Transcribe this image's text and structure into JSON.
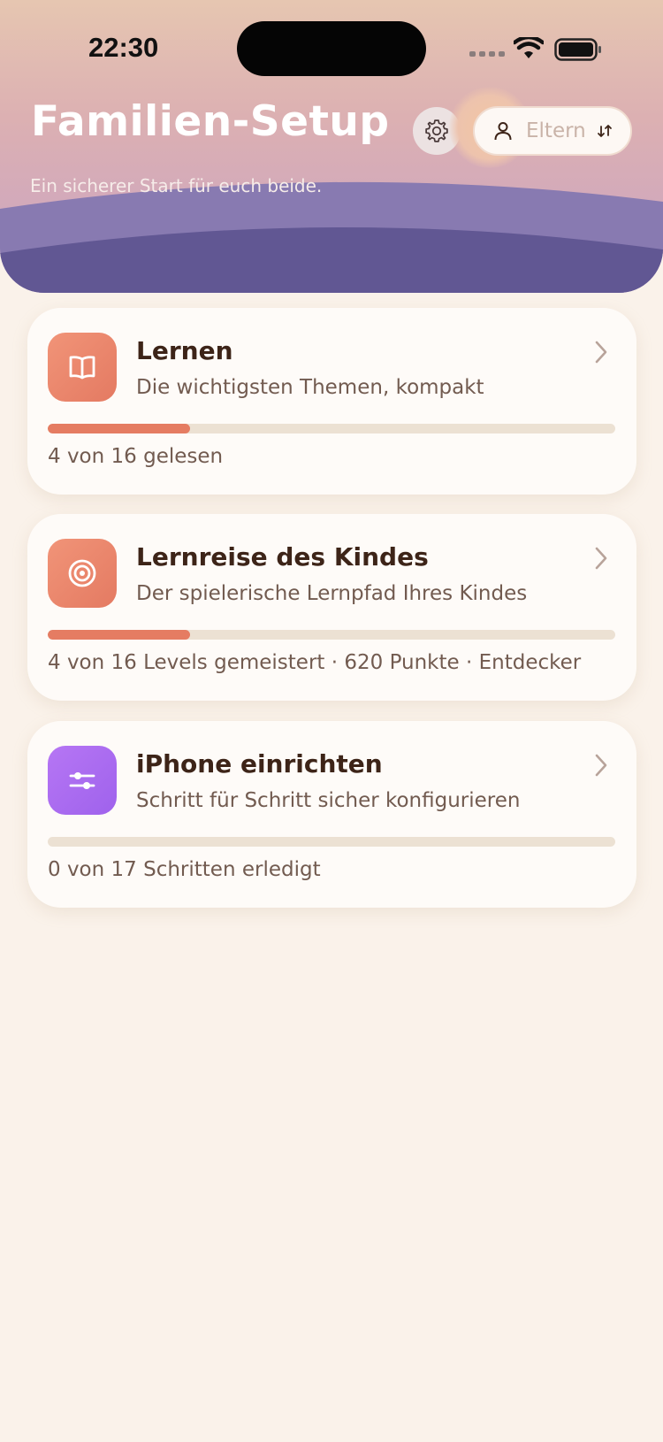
{
  "status_bar": {
    "time": "22:30"
  },
  "header": {
    "title": "Familien-Setup",
    "subtitle": "Ein sicherer Start für euch beide.",
    "settings_icon": "gear-icon",
    "role_label": "Eltern",
    "role_icon": "person-icon",
    "swap_icon": "swap-arrows-icon"
  },
  "cards": [
    {
      "title": "Lernen",
      "description": "Die wichtigsten Themen, kompakt",
      "icon": "book-icon",
      "progress": 0.25,
      "status": "4 von 16 gelesen"
    },
    {
      "title": "Lernreise des Kindes",
      "description": "Der spielerische Lernpfad Ihres Kindes",
      "icon": "target-icon",
      "progress": 0.25,
      "status": "4 von 16 Levels gemeistert · 620 Punkte · Entdecker"
    },
    {
      "title": "iPhone einrichten",
      "description": "Schritt für Schritt sicher konfigurieren",
      "icon": "sliders-icon",
      "progress": 0.0,
      "status": "0 von 17 Schritten erledigt"
    }
  ],
  "colors": {
    "accent": "#e57c62",
    "purple_icon": "#a465ee",
    "header_wave": "#615793"
  }
}
